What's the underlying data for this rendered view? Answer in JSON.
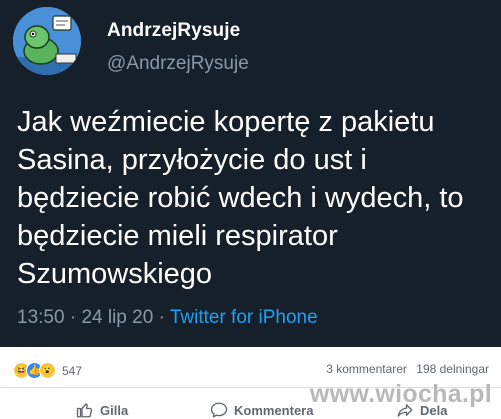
{
  "tweet": {
    "display_name": "AndrzejRysuje",
    "handle": "@AndrzejRysuje",
    "text": "Jak weźmiecie kopertę z pakietu Sasina, przyłożycie do ust i będziecie robić wdech i wydech, to będziecie mieli respirator Szumowskiego",
    "time": "13:50",
    "date": "24 lip 20",
    "source": "Twitter for iPhone",
    "background": "#15202b",
    "accent": "#1da1f2"
  },
  "facebook": {
    "reactions": [
      "haha-reaction-icon",
      "like-reaction-icon",
      "wow-reaction-icon"
    ],
    "reaction_count": "547",
    "comments": "3 kommentarer",
    "shares": "198 delningar",
    "actions": {
      "like": "Gilla",
      "comment": "Kommentera",
      "share": "Dela"
    }
  },
  "watermark": "www.wiocha.pl"
}
